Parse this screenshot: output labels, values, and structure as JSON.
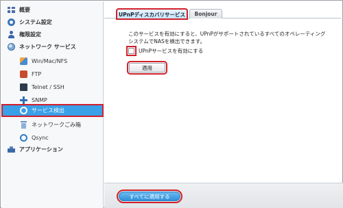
{
  "sidebar": {
    "items": [
      {
        "label": "概要",
        "icon": "overview-icon"
      },
      {
        "label": "システム設定",
        "icon": "gear-icon"
      },
      {
        "label": "権限設定",
        "icon": "user-icon"
      },
      {
        "label": "ネットワーク サービス",
        "icon": "globe-icon"
      },
      {
        "label": "Win/Mac/NFS",
        "icon": "share-icon"
      },
      {
        "label": "FTP",
        "icon": "ftp-icon"
      },
      {
        "label": "Telnet / SSH",
        "icon": "terminal-icon"
      },
      {
        "label": "SNMP",
        "icon": "snmp-icon"
      },
      {
        "label": "サービス検出",
        "icon": "radar-icon",
        "active": true
      },
      {
        "label": "ネットワークごみ箱",
        "icon": "trash-icon"
      },
      {
        "label": "Qsync",
        "icon": "qsync-icon"
      },
      {
        "label": "アプリケーション",
        "icon": "application-icon"
      }
    ]
  },
  "tabs": [
    {
      "label": "UPnPディスカバリサービス",
      "active": true
    },
    {
      "label": "Bonjour",
      "active": false
    }
  ],
  "content": {
    "description": "このサービスを有効にすると、UPnPがサポートされているすべてのオペレーティングシステムでNASを検出できます。",
    "checkbox_label": "UPnPサービスを有効にする",
    "checkbox_checked": false,
    "apply_label": "適用"
  },
  "footer": {
    "apply_all_label": "すべてに適用する"
  },
  "colors": {
    "highlight": "#d21f2a",
    "active_nav": "#3aa0e8"
  }
}
